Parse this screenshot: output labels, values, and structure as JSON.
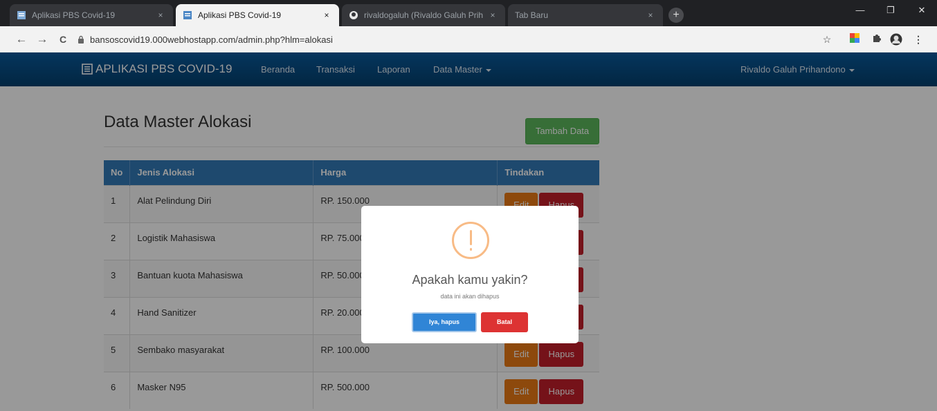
{
  "browser": {
    "tabs": [
      {
        "title": "Aplikasi PBS Covid-19",
        "active": false
      },
      {
        "title": "Aplikasi PBS Covid-19",
        "active": true
      },
      {
        "title": "rivaldogaluh (Rivaldo Galuh Prih",
        "active": false
      },
      {
        "title": "Tab Baru",
        "active": false
      }
    ],
    "tab_close": "×",
    "new_tab": "+",
    "url": "bansoscovid19.000webhostapp.com/admin.php?hlm=alokasi",
    "window": {
      "minimize": "—",
      "maximize": "❐",
      "close": "✕"
    },
    "nav": {
      "back": "←",
      "forward": "→",
      "reload": "C"
    }
  },
  "app": {
    "brand": "APLIKASI PBS COVID-19",
    "nav": {
      "beranda": "Beranda",
      "transaksi": "Transaksi",
      "laporan": "Laporan",
      "data_master": "Data Master"
    },
    "user": "Rivaldo Galuh Prihandono"
  },
  "page": {
    "title": "Data Master Alokasi",
    "add_button": "Tambah Data",
    "table": {
      "headers": {
        "no": "No",
        "jenis": "Jenis Alokasi",
        "harga": "Harga",
        "tindakan": "Tindakan"
      },
      "edit_label": "Edit",
      "delete_label": "Hapus",
      "rows": [
        {
          "no": "1",
          "jenis": "Alat Pelindung Diri",
          "harga": "RP. 150.000"
        },
        {
          "no": "2",
          "jenis": "Logistik Mahasiswa",
          "harga": "RP. 75.000"
        },
        {
          "no": "3",
          "jenis": "Bantuan kuota Mahasiswa",
          "harga": "RP. 50.000"
        },
        {
          "no": "4",
          "jenis": "Hand Sanitizer",
          "harga": "RP. 20.000"
        },
        {
          "no": "5",
          "jenis": "Sembako masyarakat",
          "harga": "RP. 100.000"
        },
        {
          "no": "6",
          "jenis": "Masker N95",
          "harga": "RP. 500.000"
        }
      ]
    }
  },
  "modal": {
    "title": "Apakah kamu yakin?",
    "text": "data ini akan dihapus",
    "confirm": "Iya, hapus",
    "cancel": "Batal"
  },
  "colors": {
    "navbar": "#03406e",
    "primary": "#337ab7",
    "success": "#5cb85c",
    "warning": "#eb7a14",
    "danger": "#c41f2a",
    "warn_icon": "#f8bb86"
  }
}
